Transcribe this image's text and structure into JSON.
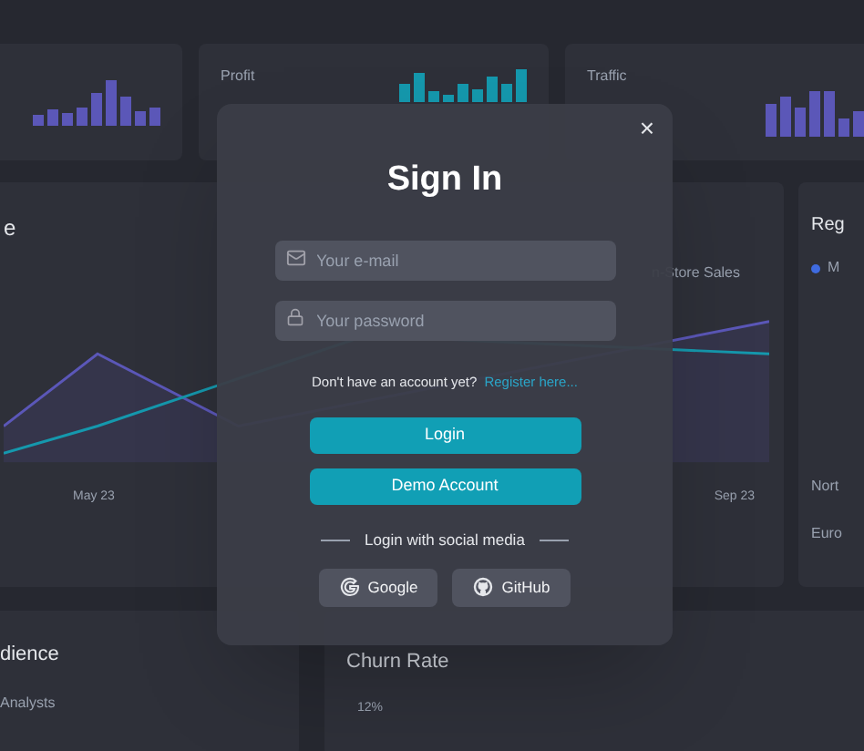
{
  "stat_cards": [
    {
      "color": "#5b57b8"
    },
    {
      "label": "Profit",
      "color": "#1598ad"
    },
    {
      "label": "Traffic",
      "color": "#5b57b8"
    }
  ],
  "sales_chart": {
    "title": "e",
    "legend": "n-Store Sales",
    "x_labels": [
      "May 23",
      "Sep 23"
    ]
  },
  "regions": {
    "title": "Reg",
    "legend": {
      "label": "M",
      "color": "#3f6be0"
    },
    "rows": [
      "Nort",
      "Euro"
    ]
  },
  "audience": {
    "title": "dience",
    "rows": [
      "Analysts"
    ]
  },
  "churn": {
    "title": "Churn Rate",
    "tick": "12%"
  },
  "modal": {
    "title": "Sign In",
    "close": "×",
    "fields": [
      {
        "kind": "email",
        "placeholder": "Your e-mail"
      },
      {
        "kind": "password",
        "placeholder": "Your password"
      }
    ],
    "register_prompt": "Don't have an account yet?",
    "register_link": "Register here...",
    "buttons": [
      "Login",
      "Demo Account"
    ],
    "social_label": "Login with social media",
    "social": [
      {
        "kind": "google",
        "label": "Google"
      },
      {
        "kind": "github",
        "label": "GitHub"
      }
    ]
  }
}
